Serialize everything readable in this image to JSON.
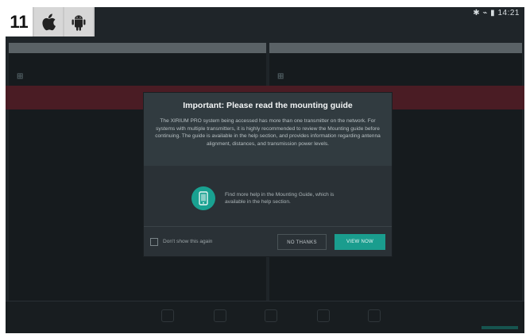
{
  "badge": {
    "number": "11",
    "platforms": [
      "apple-icon",
      "android-icon"
    ]
  },
  "status_bar": {
    "time": "14:21"
  },
  "dialog": {
    "title": "Important: Please read the mounting guide",
    "body": "The XIRIUM PRO system being accessed has more than one transmitter on the network. For systems with multiple transmitters, it is highly recommended to review the Mounting guide before continuing. The guide is available in the help section, and provides information regarding antenna alignment, distances, and transmission power levels.",
    "help_text": "Find more help in the Mounting Guide, which is available in the help section.",
    "checkbox_label": "Don't show this again",
    "no_thanks_label": "NO THANKS",
    "view_now_label": "VIEW NOW"
  },
  "colors": {
    "accent": "#1a9d8e",
    "dialog_bg": "#2a3136",
    "screen_bg": "#1f2529"
  }
}
